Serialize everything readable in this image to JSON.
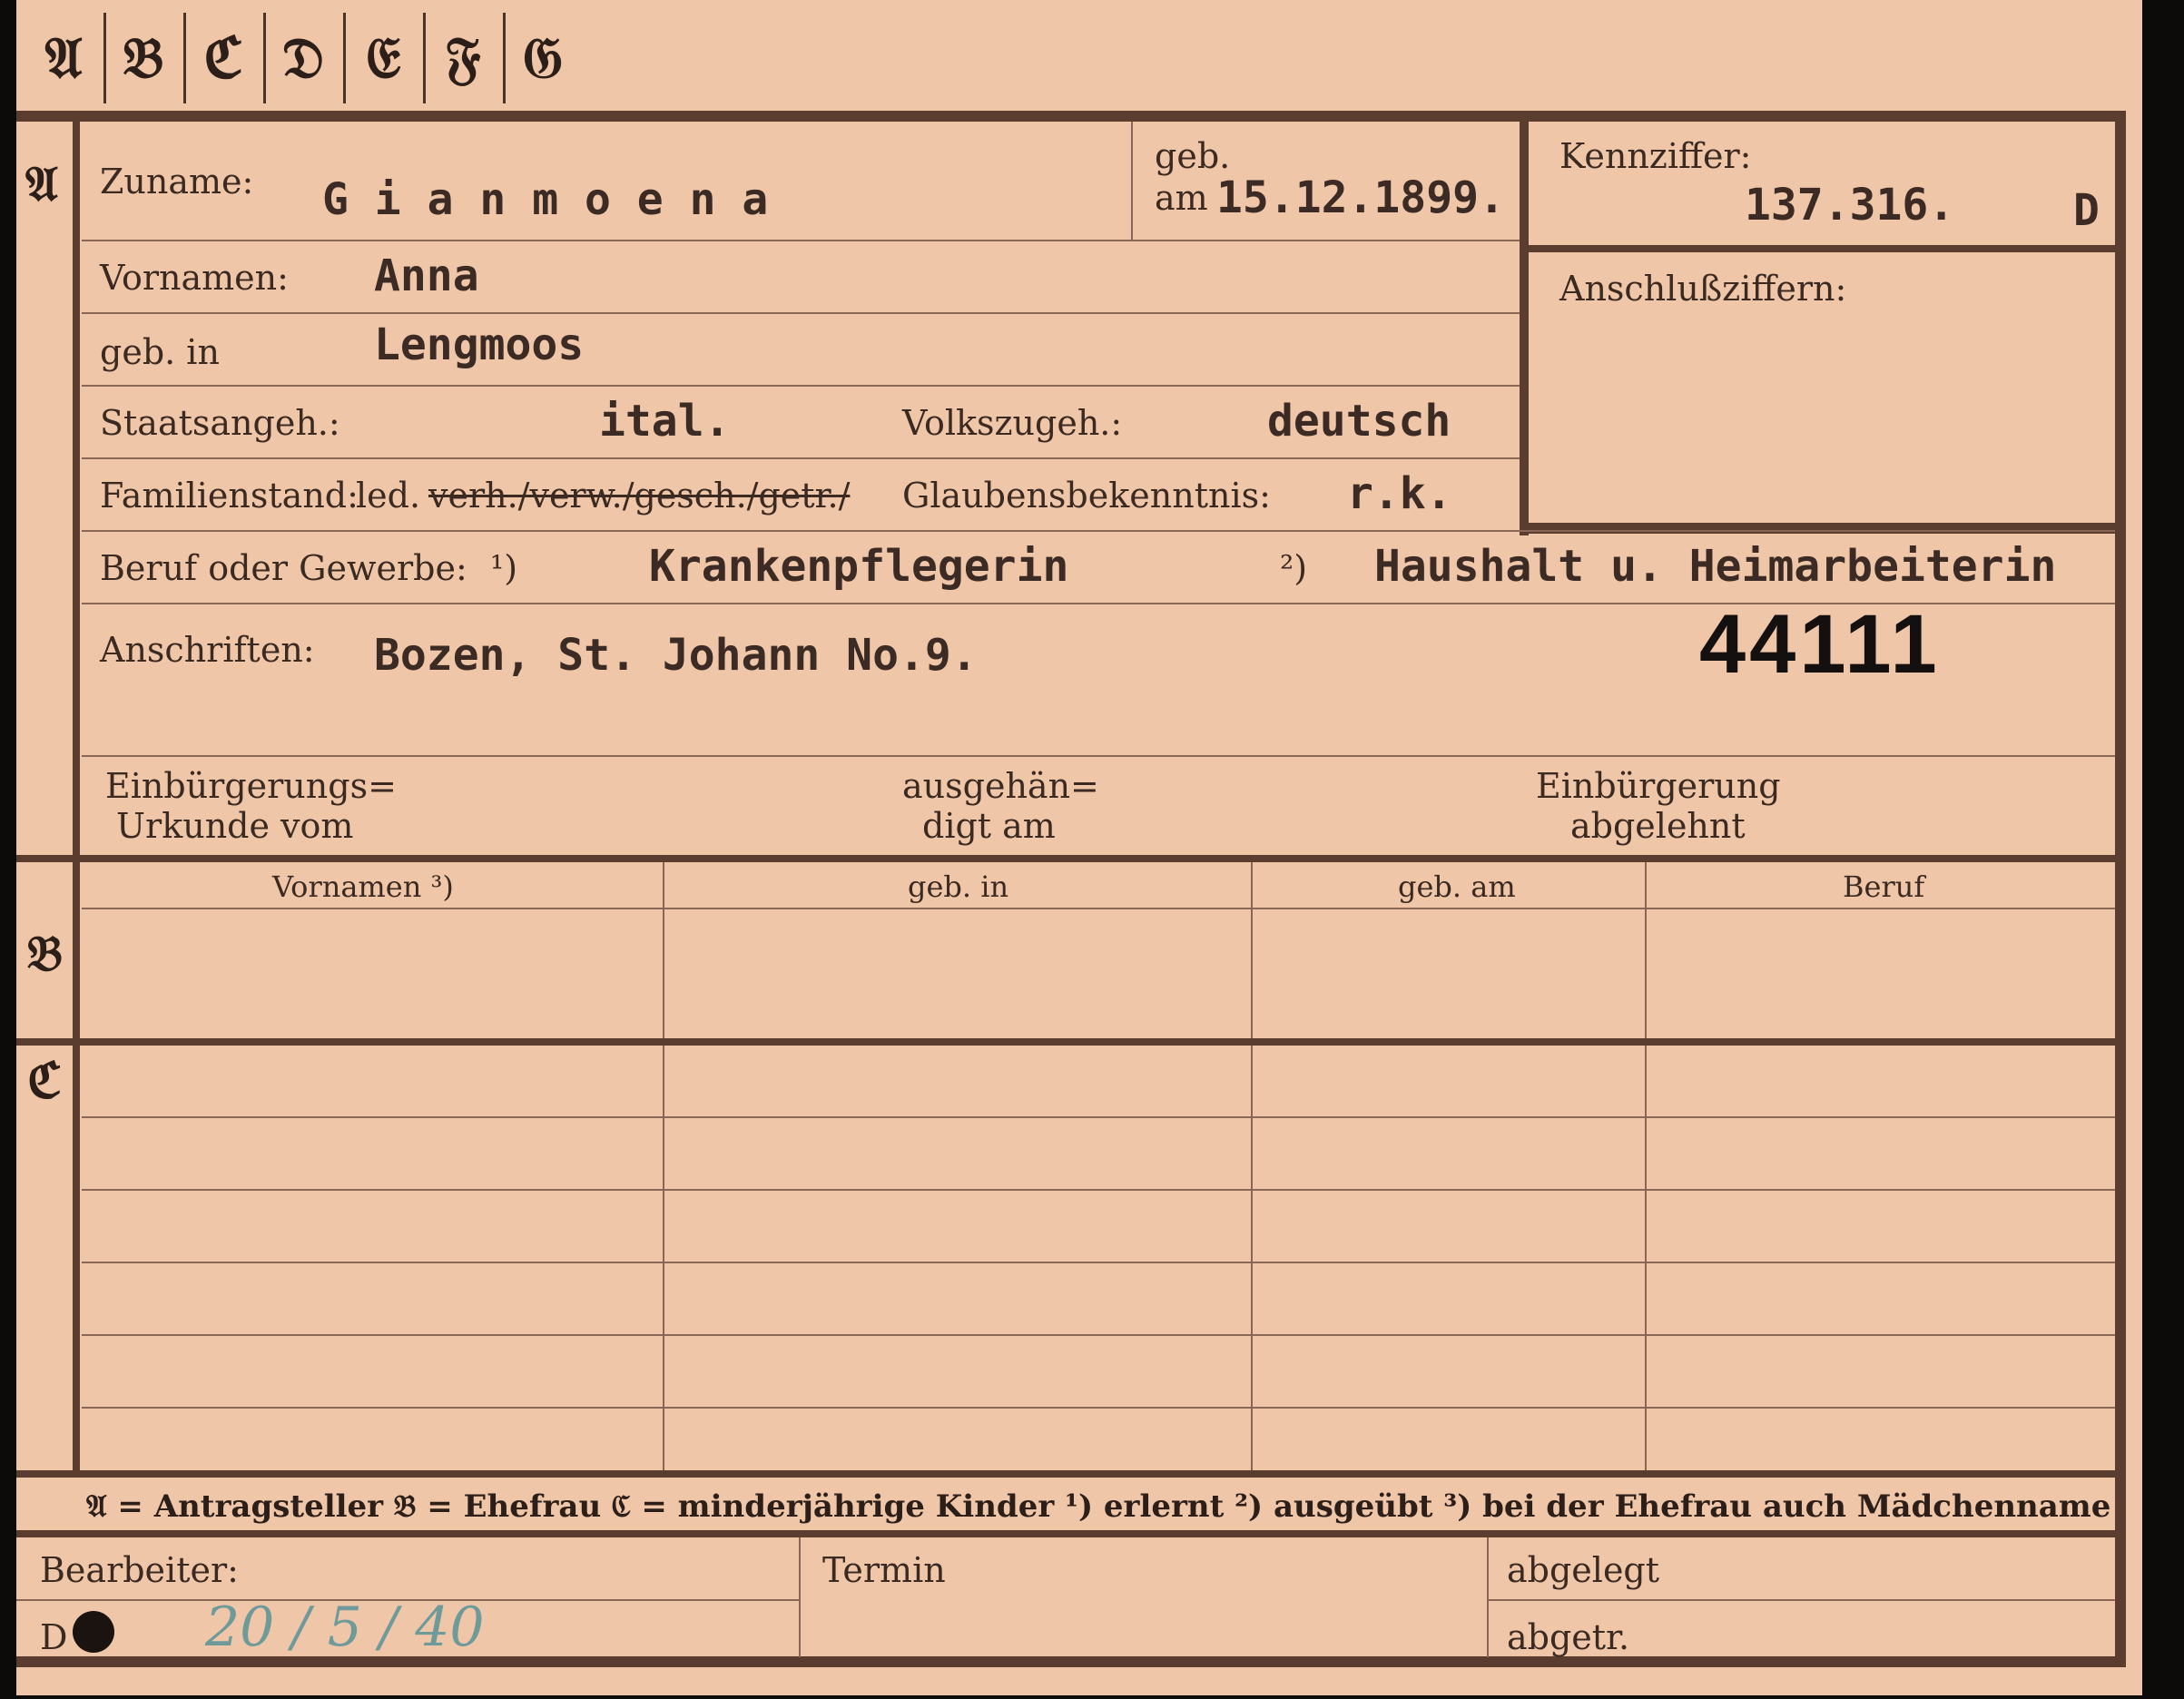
{
  "tabs": [
    "𝔄",
    "𝔅",
    "ℭ",
    "𝔇",
    "𝔈",
    "𝔉",
    "𝔊"
  ],
  "sections": {
    "a": "𝔄",
    "b": "𝔅",
    "c": "ℭ"
  },
  "labels": {
    "zuname": "Zuname:",
    "geb": "geb.",
    "am": "am",
    "kennziffer": "Kennziffer:",
    "vornamen": "Vornamen:",
    "anschlussziffern": "Anschlußziffern:",
    "geb_in": "geb. in",
    "staatsangeh": "Staatsangeh.:",
    "volkszugeh": "Volkszugeh.:",
    "familienstand": "Familienstand:",
    "glaubensbekenntnis": "Glaubensbekenntnis:",
    "beruf": "Beruf oder Gewerbe:",
    "beruf_note1": "¹)",
    "beruf_note2": "²)",
    "anschriften": "Anschriften:",
    "einbuergerung_urkunde_1": "Einbürgerungs=",
    "einbuergerung_urkunde_2": "Urkunde vom",
    "ausgehaendigt_1": "ausgehän=",
    "ausgehaendigt_2": "digt am",
    "einbuergerung_abgelehnt_1": "Einbürgerung",
    "einbuergerung_abgelehnt_2": "abgelehnt"
  },
  "values": {
    "zuname": "G i a n m o e n a",
    "geb_am": "15.12.1899.",
    "kennziffer": "137.316.",
    "kennziffer_suffix": "D",
    "vornamen": "Anna",
    "geb_in": "Lengmoos",
    "staatsangeh": "ital.",
    "volkszugeh": "deutsch",
    "familienstand_ok": "led.",
    "familienstand_struck": "verh./verw./gesch./getr./",
    "glaubensbekenntnis": "r.k.",
    "beruf1": "Krankenpflegerin",
    "beruf2": "Haushalt u. Heimarbeiterin",
    "anschriften": "Bozen, St. Johann  No.9.",
    "number": "44111"
  },
  "table_headers": [
    "Vornamen ³)",
    "geb. in",
    "geb. am",
    "Beruf"
  ],
  "legend": "𝔄 = Antragsteller   𝔅 = Ehefrau   ℭ = minderjährige Kinder   ¹) erlernt   ²) ausgeübt   ³) bei der Ehefrau auch Mädchenname",
  "footer": {
    "bearbeiter": "Bearbeiter:",
    "termin": "Termin",
    "abgelegt": "abgelegt",
    "abgetr": "abgetr.",
    "d_label": "D",
    "date_handwritten": "20 / 5 / 40"
  }
}
